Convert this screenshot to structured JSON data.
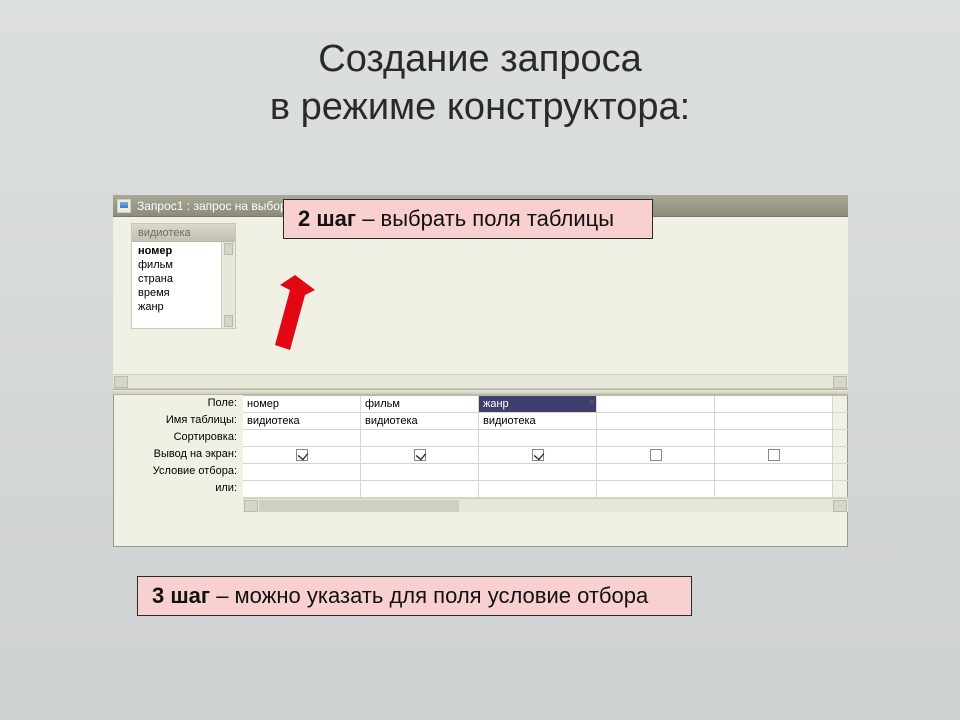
{
  "title": {
    "line1": "Создание запроса",
    "line2": "в режиме конструктора:"
  },
  "callouts": {
    "step2_bold": "2 шаг",
    "step2_rest": " – выбрать поля таблицы",
    "step3_bold": "3 шаг",
    "step3_rest": " – можно указать для поля условие отбора"
  },
  "window": {
    "title": "Запрос1 : запрос на выборку",
    "source_table_name": "видиотека",
    "source_table_fields": [
      "номер",
      "фильм",
      "страна",
      "время",
      "жанр"
    ]
  },
  "grid": {
    "row_labels": {
      "field": "Поле:",
      "table": "Имя таблицы:",
      "sort": "Сортировка:",
      "show": "Вывод на экран:",
      "criteria": "Условие отбора:",
      "or": "или:"
    },
    "columns": [
      {
        "field": "номер",
        "table": "видиотека",
        "sort": "",
        "show": true,
        "criteria": "",
        "or": "",
        "selected": false
      },
      {
        "field": "фильм",
        "table": "видиотека",
        "sort": "",
        "show": true,
        "criteria": "",
        "or": "",
        "selected": false
      },
      {
        "field": "жанр",
        "table": "видиотека",
        "sort": "",
        "show": true,
        "criteria": "",
        "or": "",
        "selected": true
      },
      {
        "field": "",
        "table": "",
        "sort": "",
        "show": false,
        "criteria": "",
        "or": "",
        "selected": false
      },
      {
        "field": "",
        "table": "",
        "sort": "",
        "show": false,
        "criteria": "",
        "or": "",
        "selected": false
      }
    ]
  }
}
